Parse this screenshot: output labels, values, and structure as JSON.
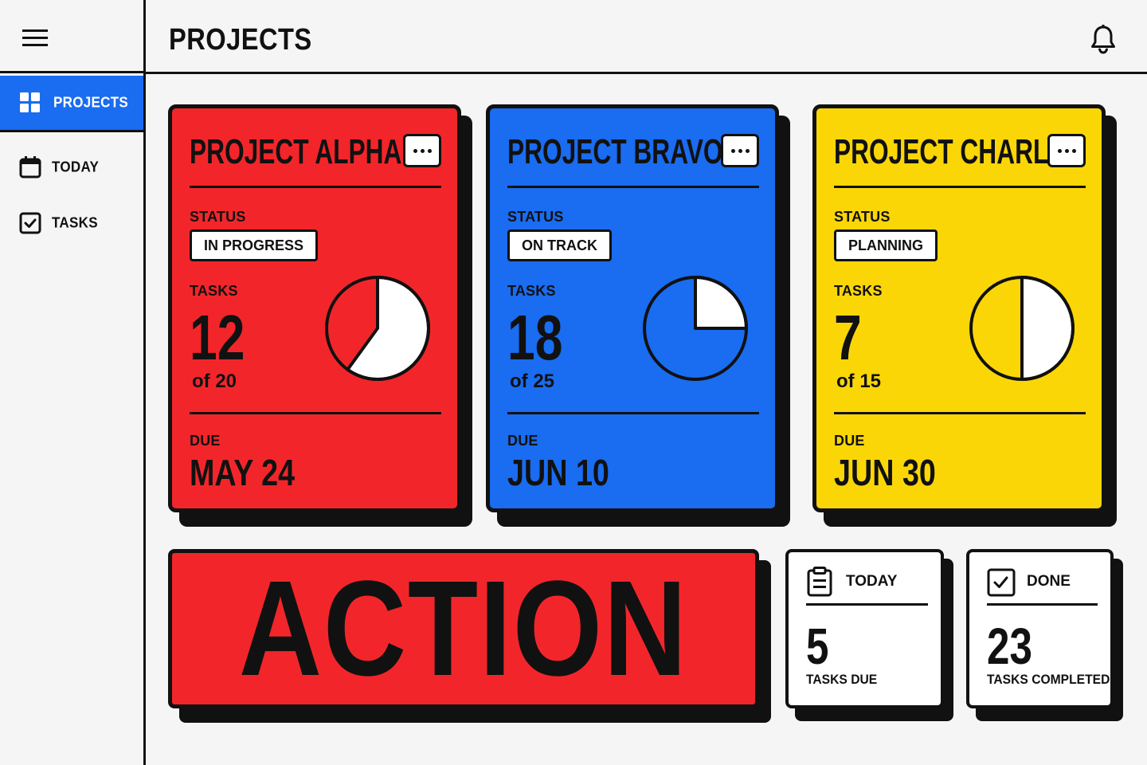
{
  "sidebar": {
    "items": [
      {
        "label": "PROJECTS",
        "icon": "grid-icon",
        "active": true
      },
      {
        "label": "TODAY",
        "icon": "calendar-icon",
        "active": false
      },
      {
        "label": "TASKS",
        "icon": "checkbox-icon",
        "active": false
      }
    ]
  },
  "header": {
    "title": "PROJECTS",
    "notification_icon": "bell-icon"
  },
  "colors": {
    "red": "#f2262a",
    "blue": "#1a6cf0",
    "yellow": "#fbd607",
    "ink": "#111111"
  },
  "projects": [
    {
      "title": "PROJECT ALPHA",
      "status_label": "STATUS",
      "status": "IN PROGRESS",
      "tasks_label": "TASKS",
      "tasks_done": "12",
      "tasks_total_text": "of 20",
      "progress": 0.6,
      "due_label": "DUE",
      "due": "MAY 24"
    },
    {
      "title": "PROJECT BRAVO",
      "status_label": "STATUS",
      "status": "ON TRACK",
      "tasks_label": "TASKS",
      "tasks_done": "18",
      "tasks_total_text": "of 25",
      "progress": 0.25,
      "due_label": "DUE",
      "due": "JUN 10"
    },
    {
      "title": "PROJECT CHARLIE",
      "status_label": "STATUS",
      "status": "PLANNING",
      "tasks_label": "TASKS",
      "tasks_done": "7",
      "tasks_total_text": "of 15",
      "progress": 0.5,
      "due_label": "DUE",
      "due": "JUN 30"
    }
  ],
  "action": {
    "label": "ACTION"
  },
  "stats": [
    {
      "title": "TODAY",
      "icon": "clipboard-icon",
      "value": "5",
      "caption": "TASKS DUE"
    },
    {
      "title": "DONE",
      "icon": "checkbox-icon",
      "value": "23",
      "caption": "TASKS COMPLETED"
    }
  ]
}
